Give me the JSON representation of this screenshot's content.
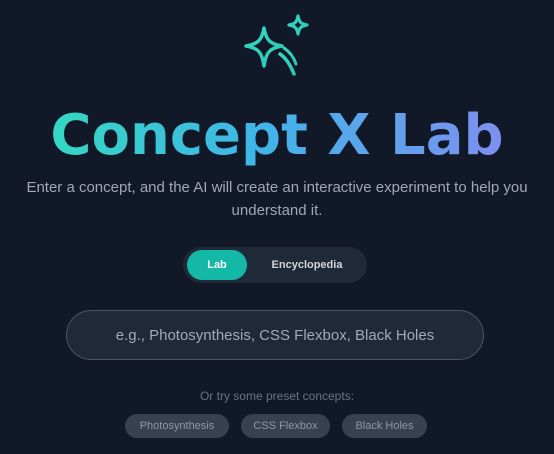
{
  "app": {
    "title": "Concept X Lab",
    "subtitle": "Enter a concept, and the AI will create an interactive experiment to help you understand it."
  },
  "mode_toggle": {
    "options": [
      {
        "label": "Lab",
        "active": true
      },
      {
        "label": "Encyclopedia",
        "active": false
      }
    ]
  },
  "search": {
    "value": "",
    "placeholder": "e.g., Photosynthesis, CSS Flexbox, Black Holes"
  },
  "presets": {
    "label": "Or try some preset concepts:",
    "items": [
      "Photosynthesis",
      "CSS Flexbox",
      "Black Holes"
    ]
  },
  "icons": {
    "logo": "sparkles-icon"
  },
  "colors": {
    "background": "#111827",
    "accent": "#14b8a6",
    "gradient_start": "#34d8c2",
    "gradient_end": "#7e8ff0"
  }
}
